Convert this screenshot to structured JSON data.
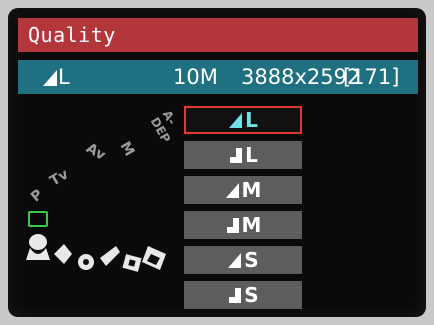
{
  "menu": {
    "title": "Quality"
  },
  "current": {
    "quality": "L",
    "megapixels": "10M",
    "resolution": "3888x2592",
    "shots": "[171]"
  },
  "options": [
    {
      "label": "L",
      "compression": "fine",
      "selected": true
    },
    {
      "label": "L",
      "compression": "normal",
      "selected": false
    },
    {
      "label": "M",
      "compression": "fine",
      "selected": false
    },
    {
      "label": "M",
      "compression": "normal",
      "selected": false
    },
    {
      "label": "S",
      "compression": "fine",
      "selected": false
    },
    {
      "label": "S",
      "compression": "normal",
      "selected": false
    }
  ],
  "mode_dial": {
    "labels": [
      "A-DEP",
      "M",
      "Av",
      "Tv",
      "P"
    ]
  },
  "colors": {
    "title_bg": "#b3363b",
    "info_bg": "#1f7080",
    "selection": "#e0392f",
    "selected_text": "#6fe0e8",
    "auto_mode": "#3ec84a"
  }
}
